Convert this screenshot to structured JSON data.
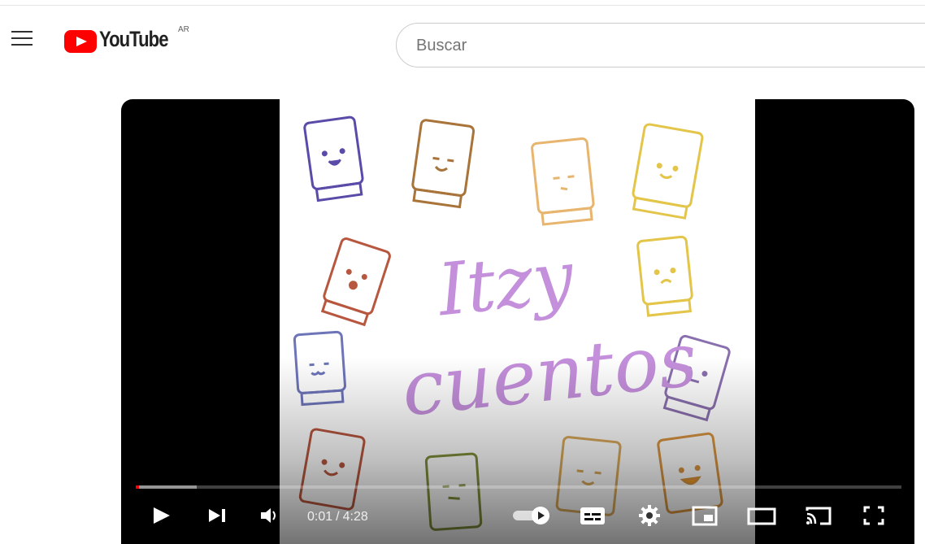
{
  "masthead": {
    "logo_text": "YouTube",
    "country_code": "AR",
    "search_placeholder": "Buscar"
  },
  "player": {
    "current_time": "0:01",
    "time_separator": "/",
    "duration": "4:28",
    "progress": {
      "played_fraction": 0.004,
      "buffered_fraction": 0.08
    },
    "thumbnail_lettering": [
      "Itzy",
      "cuentos"
    ],
    "controls": [
      "play-icon",
      "next-icon",
      "volume-icon",
      "autoplay-toggle",
      "subtitles-icon",
      "settings-icon",
      "miniplayer-icon",
      "theater-mode-icon",
      "cast-icon",
      "fullscreen-icon"
    ]
  },
  "colors": {
    "brand_red": "#ff0000",
    "lettering": "#c48fdb"
  }
}
